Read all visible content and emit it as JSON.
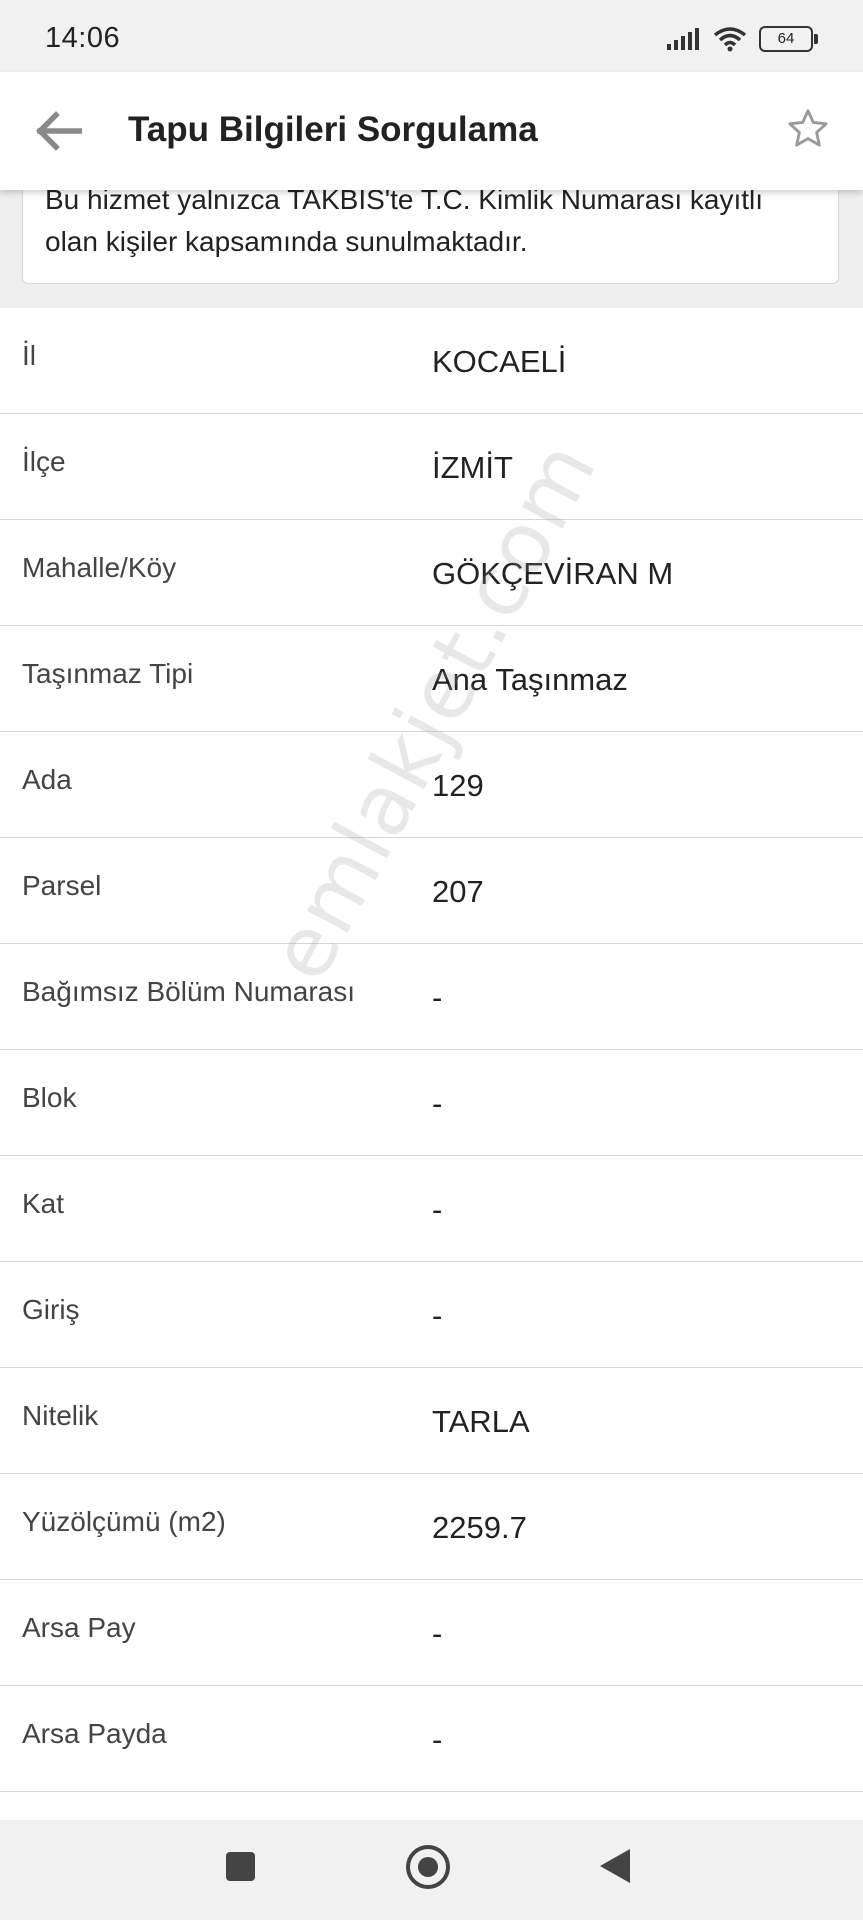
{
  "status_bar": {
    "time": "14:06",
    "battery": "64",
    "icons": [
      "signal-icon",
      "wifi-icon",
      "battery-icon"
    ]
  },
  "app_bar": {
    "title": "Tapu Bilgileri Sorgulama",
    "back_icon": "arrow-left-icon",
    "star_icon": "star-outline-icon"
  },
  "notice": {
    "line1": "Bu hizmet yalnızca TAKBİS'te T.C. Kimlik Numarası kayıtlı",
    "line2": "olan kişiler kapsamında sunulmaktadır."
  },
  "rows": [
    {
      "label": "İl",
      "value": "KOCAELİ"
    },
    {
      "label": "İlçe",
      "value": "İZMİT"
    },
    {
      "label": "Mahalle/Köy",
      "value": "GÖKÇEVİRAN M"
    },
    {
      "label": "Taşınmaz Tipi",
      "value": "Ana Taşınmaz"
    },
    {
      "label": "Ada",
      "value": "129"
    },
    {
      "label": "Parsel",
      "value": "207"
    },
    {
      "label": "Bağımsız Bölüm Numarası",
      "value": "-"
    },
    {
      "label": "Blok",
      "value": "-"
    },
    {
      "label": "Kat",
      "value": "-"
    },
    {
      "label": "Giriş",
      "value": "-"
    },
    {
      "label": "Nitelik",
      "value": "TARLA"
    },
    {
      "label": "Yüzölçümü (m2)",
      "value": "2259.7"
    },
    {
      "label": "Arsa Pay",
      "value": "-"
    },
    {
      "label": "Arsa Payda",
      "value": "-"
    }
  ],
  "watermark": "emlakjet.com",
  "nav_bar": {
    "icons": [
      "recents-square-icon",
      "home-circle-icon",
      "back-triangle-icon"
    ]
  }
}
